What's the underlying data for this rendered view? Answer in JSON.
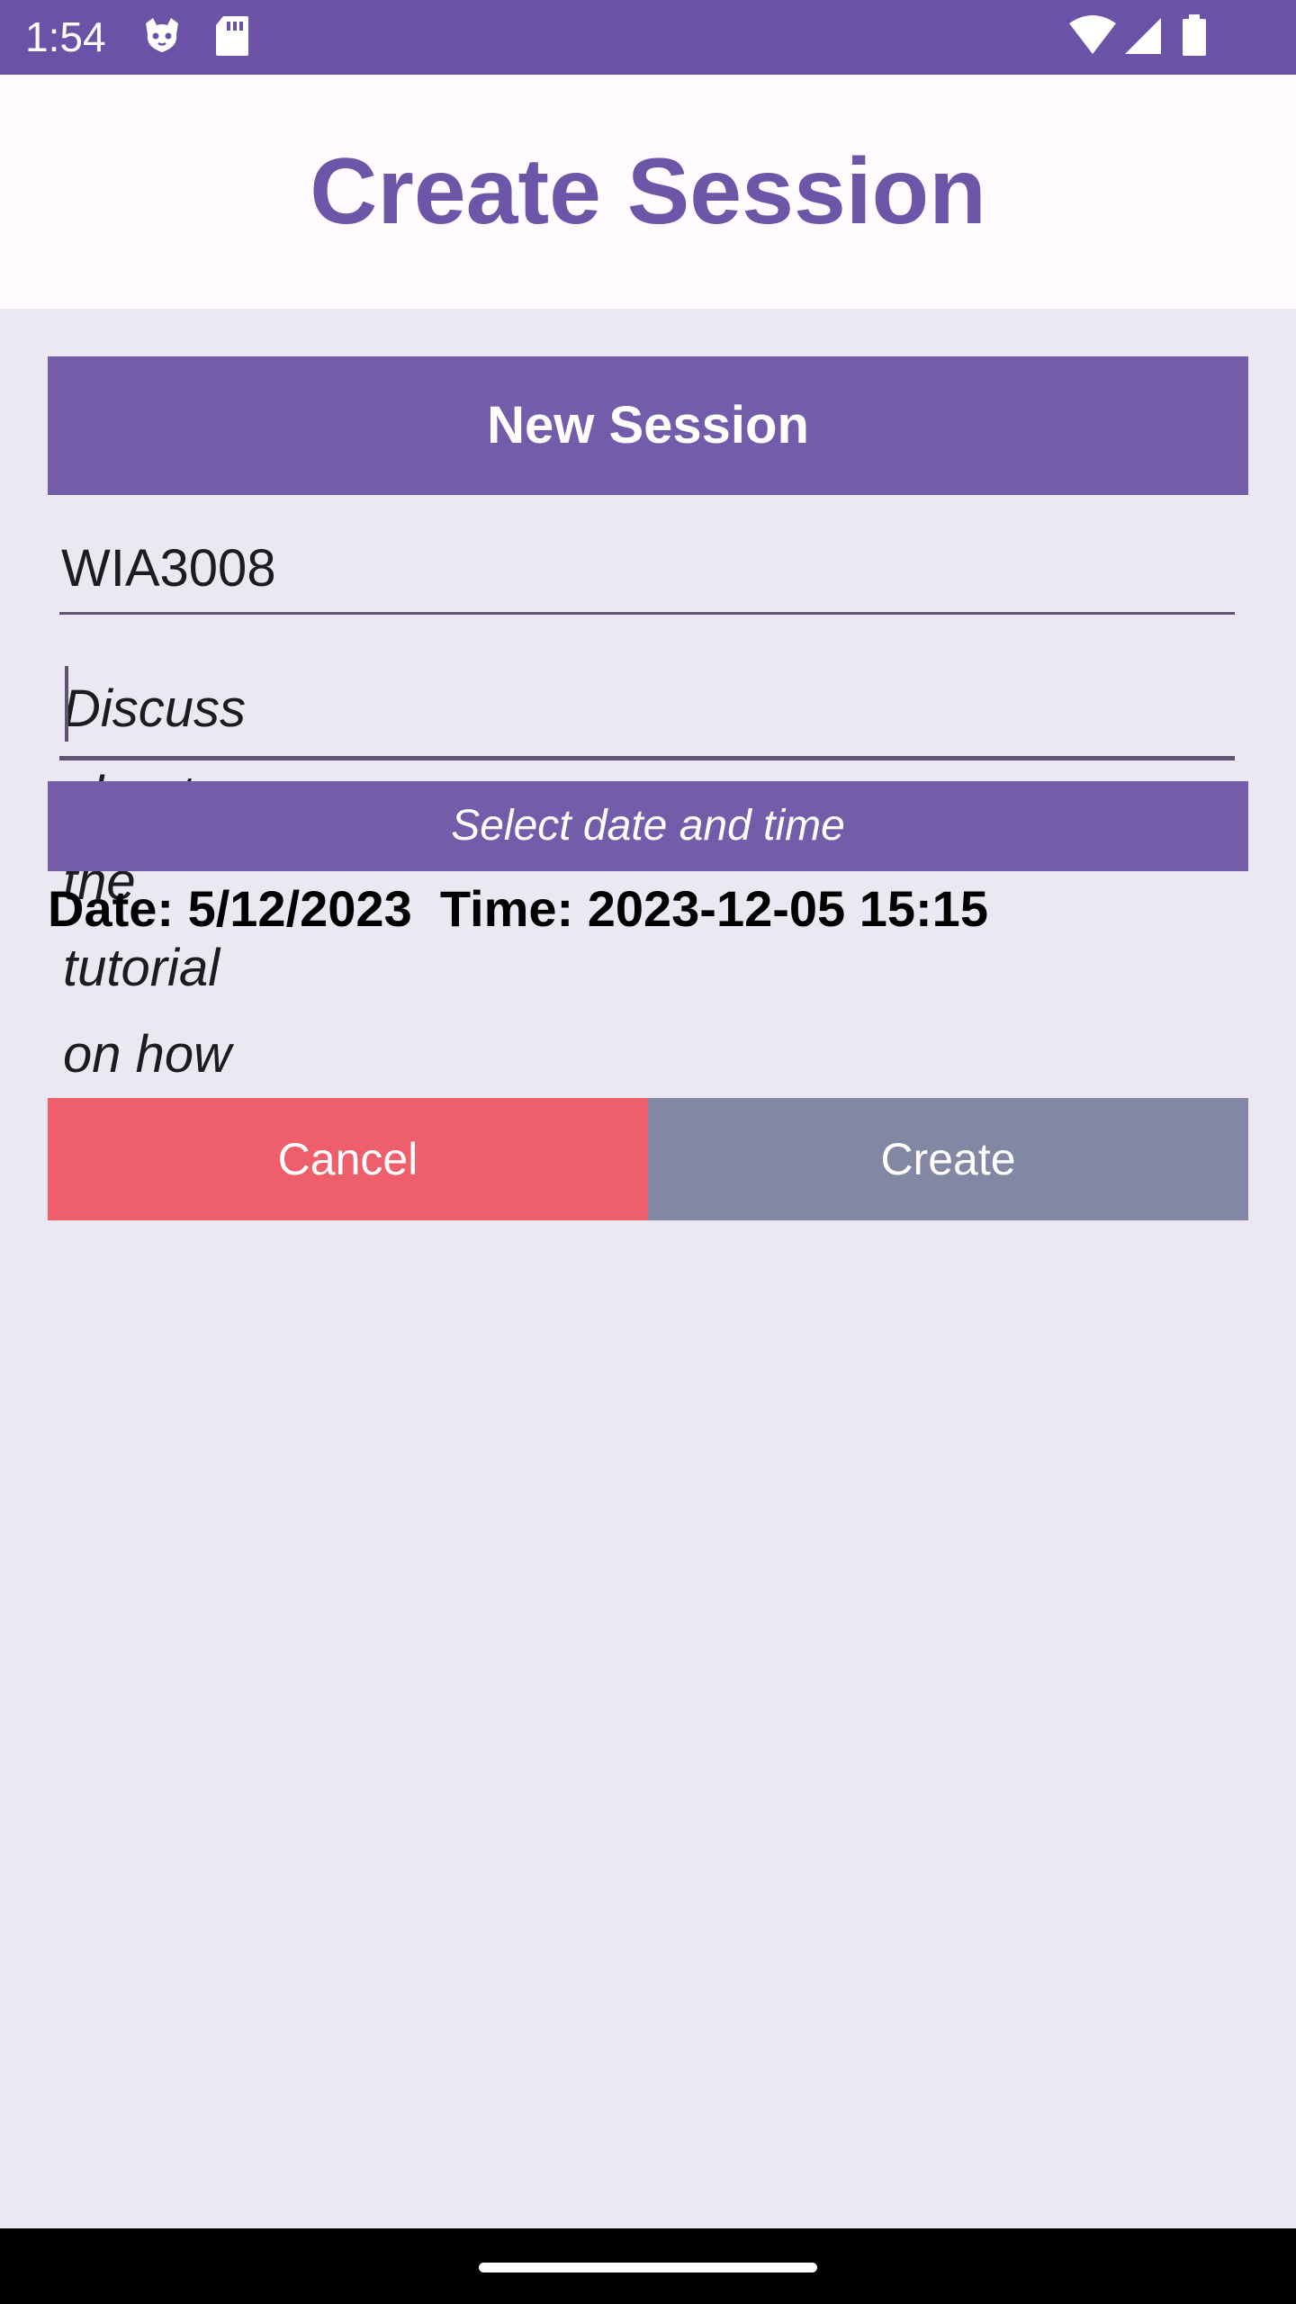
{
  "status_bar": {
    "time": "1:54",
    "left_icons": [
      "cat-face-icon",
      "sd-card-icon"
    ],
    "right_icons": [
      "wifi-icon",
      "cell-signal-icon",
      "battery-icon"
    ],
    "background": "#6a52a6"
  },
  "header": {
    "title": "Create Session",
    "title_color": "#6d55a8"
  },
  "form": {
    "section_title": "New Session",
    "course_code_value": "WIA3008",
    "description_value": "Discuss about the tutorial on how to...",
    "date_time_button_label": "Select date and time",
    "selected_date_time": "Date: 5/12/2023  Time: 2023-12-05 15:15"
  },
  "actions": {
    "cancel_label": "Cancel",
    "create_label": "Create",
    "cancel_color": "#ef5e6b",
    "create_color": "#8287a3"
  },
  "colors": {
    "accent": "#735ca9",
    "background": "#ece8f2"
  }
}
